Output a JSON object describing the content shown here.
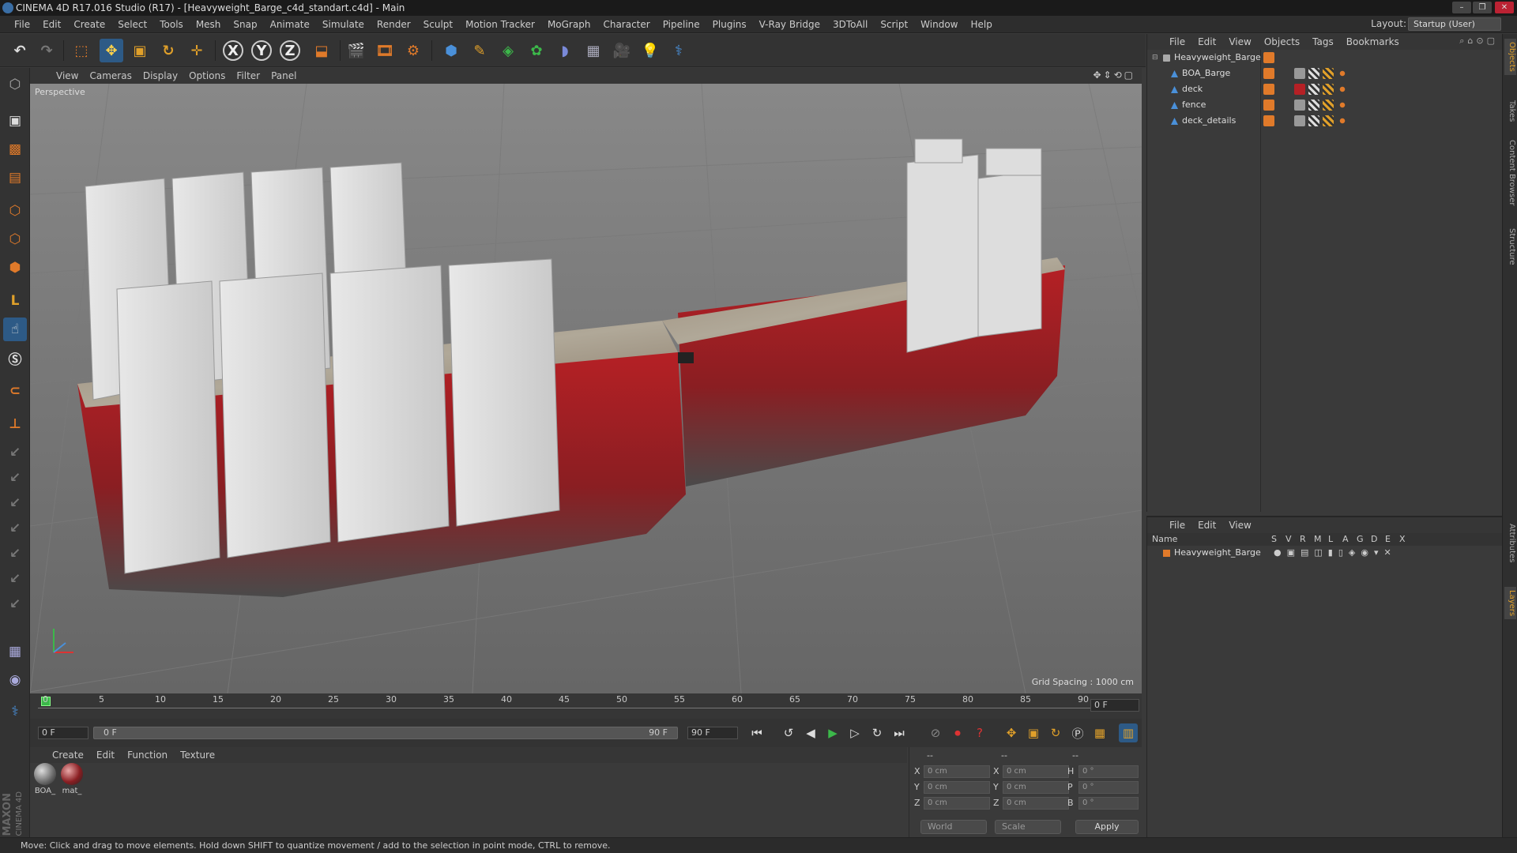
{
  "window": {
    "title": "CINEMA 4D R17.016 Studio (R17) - [Heavyweight_Barge_c4d_standart.c4d] - Main",
    "controls": [
      "–",
      "❐",
      "✕"
    ]
  },
  "menubar": {
    "items": [
      "File",
      "Edit",
      "Create",
      "Select",
      "Tools",
      "Mesh",
      "Snap",
      "Animate",
      "Simulate",
      "Render",
      "Sculpt",
      "Motion Tracker",
      "MoGraph",
      "Character",
      "Pipeline",
      "Plugins",
      "V-Ray Bridge",
      "3DToAll",
      "Script",
      "Window",
      "Help"
    ],
    "layout_label": "Layout:",
    "layout_value": "Startup (User)"
  },
  "toolbar": {
    "axis_x": "X",
    "axis_y": "Y",
    "axis_z": "Z"
  },
  "viewport": {
    "menu": [
      "View",
      "Cameras",
      "Display",
      "Options",
      "Filter",
      "Panel"
    ],
    "label": "Perspective",
    "grid_spacing": "Grid Spacing : 1000 cm"
  },
  "timeline": {
    "ticks": [
      "0",
      "5",
      "10",
      "15",
      "20",
      "25",
      "30",
      "35",
      "40",
      "45",
      "50",
      "55",
      "60",
      "65",
      "70",
      "75",
      "80",
      "85",
      "90"
    ],
    "current_frame_end": "0 F",
    "frame_start": "0 F",
    "range_start": "0 F",
    "range_end": "90 F",
    "frame_end": "90 F"
  },
  "materials": {
    "menu": [
      "Create",
      "Edit",
      "Function",
      "Texture"
    ],
    "items": [
      {
        "label": "BOA_"
      },
      {
        "label": "mat_"
      }
    ]
  },
  "coordinates": {
    "headers": [
      "--",
      "--",
      "--"
    ],
    "rows": [
      {
        "a": "X",
        "av": "0 cm",
        "b": "X",
        "bv": "0 cm",
        "c": "H",
        "cv": "0 °"
      },
      {
        "a": "Y",
        "av": "0 cm",
        "b": "Y",
        "bv": "0 cm",
        "c": "P",
        "cv": "0 °"
      },
      {
        "a": "Z",
        "av": "0 cm",
        "b": "Z",
        "bv": "0 cm",
        "c": "B",
        "cv": "0 °"
      }
    ],
    "mode": "World",
    "scale": "Scale",
    "apply": "Apply"
  },
  "object_manager": {
    "menu": [
      "File",
      "Edit",
      "View",
      "Objects",
      "Tags",
      "Bookmarks"
    ],
    "objects": [
      {
        "name": "Heavyweight_Barge",
        "level": 0
      },
      {
        "name": "BOA_Barge",
        "level": 1
      },
      {
        "name": "deck",
        "level": 1
      },
      {
        "name": "fence",
        "level": 1
      },
      {
        "name": "deck_details",
        "level": 1
      }
    ]
  },
  "layer_manager": {
    "menu": [
      "File",
      "Edit",
      "View"
    ],
    "header_name": "Name",
    "columns": [
      "S",
      "V",
      "R",
      "M",
      "L",
      "A",
      "G",
      "D",
      "E",
      "X"
    ],
    "layers": [
      {
        "name": "Heavyweight_Barge"
      }
    ]
  },
  "side_tabs": [
    "Objects",
    "Takes",
    "Content Browser",
    "Structure",
    "Attributes",
    "Layers"
  ],
  "statusbar": {
    "text": "Move: Click and drag to move elements. Hold down SHIFT to quantize movement / add to the selection in point mode, CTRL to remove."
  },
  "brand": {
    "maxon": "MAXON",
    "cinema": "CINEMA 4D"
  },
  "colors": {
    "accent_orange": "#e07a2a",
    "accent_blue": "#4a90d9",
    "hull_red": "#b52025"
  }
}
